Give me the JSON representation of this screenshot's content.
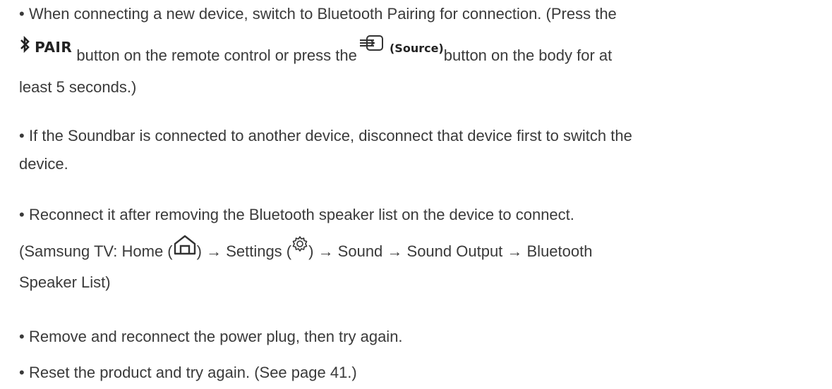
{
  "bullets": {
    "b1": {
      "line1": "When connecting a new device, switch to Bluetooth Pairing for connection. (Press the",
      "pair_label": "PAIR",
      "mid1": "button on the remote control or press the",
      "source_label": "(Source)",
      "mid2": "button on the body for at",
      "line3": "least 5 seconds.)"
    },
    "b2": {
      "line1": "If the Soundbar is connected to another device, disconnect that device first to switch the",
      "line2": "device."
    },
    "b3": {
      "line1": "Reconnect it after removing the Bluetooth speaker list on the device to connect.",
      "p_open": "(Samsung TV: Home (",
      "p_mid": ") → Settings (",
      "p_end": ") → Sound → Sound Output → Bluetooth",
      "line3": "Speaker List)"
    },
    "b4": {
      "line1": "Remove and reconnect the power plug, then try again."
    },
    "b5": {
      "line1": "Reset the product and try again. (See page 41.)"
    }
  },
  "bullet_char": "•",
  "icons": {
    "bluetooth": "bluetooth-icon",
    "source": "source-input-icon",
    "home": "home-icon",
    "settings": "gear-icon"
  }
}
